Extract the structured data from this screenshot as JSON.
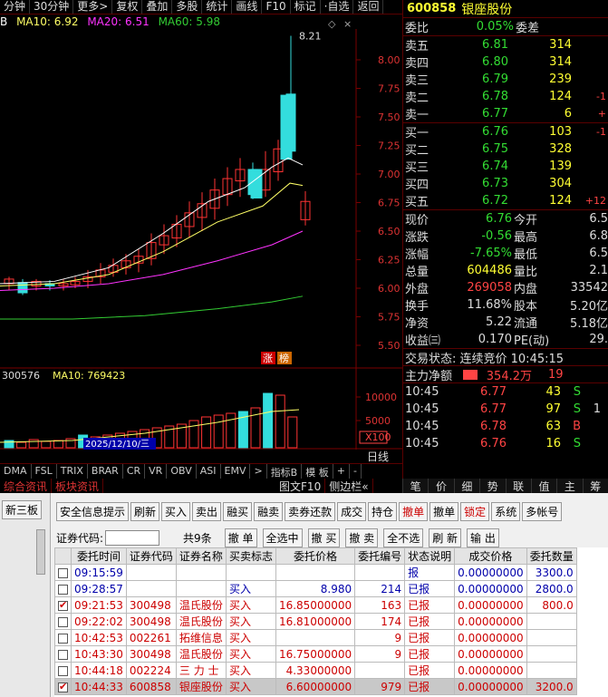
{
  "toolbar": [
    "分钟",
    "30分钟",
    "更多>",
    "复权",
    "叠加",
    "多股",
    "统计",
    "画线",
    "F10",
    "标记",
    "·自选",
    "返回"
  ],
  "ma_legend": {
    "ma5": "B",
    "ma10": "MA10: 6.92",
    "ma20": "MA20: 6.51",
    "ma60": "MA60: 5.98"
  },
  "chart": {
    "price_axis": [
      "8.00",
      "7.75",
      "7.50",
      "7.25",
      "7.00",
      "6.75",
      "6.50",
      "6.25",
      "6.00",
      "5.75",
      "5.50"
    ],
    "high_label": "8.21",
    "badges": [
      "涨",
      "榜"
    ],
    "vol_legend": "300576",
    "vol_ma": "MA10: 769423",
    "vol_axis": [
      "10000",
      "5000",
      "X100"
    ],
    "date_label": "2025/12/10/三",
    "period": "日线",
    "colors": {
      "up": "#ff3333",
      "down": "#33dddd",
      "ma5": "#ffffff",
      "ma10": "#ffff66",
      "ma20": "#ff33ff",
      "ma60": "#33cc33"
    }
  },
  "indicator_tabs": [
    "DMA",
    "FSL",
    "TRIX",
    "BRAR",
    "CR",
    "VR",
    "OBV",
    "ASI",
    "EMV",
    ">",
    "指标B",
    "模 板",
    "+",
    "-"
  ],
  "bottom_tabs": [
    "综合资讯",
    "板块资讯",
    "图文F10",
    "侧边栏«"
  ],
  "bottom_right_tabs": [
    "笔",
    "价",
    "细",
    "势",
    "联",
    "值",
    "主",
    "筹"
  ],
  "quote": {
    "code": "600858",
    "name": "银座股份",
    "weibi_label": "委比",
    "weibi_value": "0.05%",
    "weicha_label": "委差",
    "asks": [
      {
        "label": "卖五",
        "price": "6.81",
        "vol": "314",
        "chg": ""
      },
      {
        "label": "卖四",
        "price": "6.80",
        "vol": "314",
        "chg": ""
      },
      {
        "label": "卖三",
        "price": "6.79",
        "vol": "239",
        "chg": ""
      },
      {
        "label": "卖二",
        "price": "6.78",
        "vol": "124",
        "chg": "-1"
      },
      {
        "label": "卖一",
        "price": "6.77",
        "vol": "6",
        "chg": "+"
      }
    ],
    "bids": [
      {
        "label": "买一",
        "price": "6.76",
        "vol": "103",
        "chg": "-1"
      },
      {
        "label": "买二",
        "price": "6.75",
        "vol": "328",
        "chg": ""
      },
      {
        "label": "买三",
        "price": "6.74",
        "vol": "139",
        "chg": ""
      },
      {
        "label": "买四",
        "price": "6.73",
        "vol": "304",
        "chg": ""
      },
      {
        "label": "买五",
        "price": "6.72",
        "vol": "124",
        "chg": "+12"
      }
    ],
    "stats": [
      {
        "l1": "现价",
        "v1": "6.76",
        "l2": "今开",
        "v2": "6.5"
      },
      {
        "l1": "涨跌",
        "v1": "-0.56",
        "l2": "最高",
        "v2": "6.8"
      },
      {
        "l1": "涨幅",
        "v1": "-7.65%",
        "l2": "最低",
        "v2": "6.5"
      },
      {
        "l1": "总量",
        "v1": "604486",
        "l2": "量比",
        "v2": "2.1"
      },
      {
        "l1": "外盘",
        "v1": "269058",
        "l2": "内盘",
        "v2": "33542"
      },
      {
        "l1": "换手",
        "v1": "11.68%",
        "l2": "股本",
        "v2": "5.20亿"
      },
      {
        "l1": "净资",
        "v1": "5.22",
        "l2": "流通",
        "v2": "5.18亿"
      },
      {
        "l1": "收益㈢",
        "v1": "0.170",
        "l2": "PE(动)",
        "v2": "29."
      }
    ],
    "trade_status": "交易状态: 连续竞价 10:45:15",
    "main_flow_label": "主力净额",
    "main_flow_value": "354.2万",
    "main_flow_extra": "19",
    "ticks": [
      {
        "time": "10:45",
        "price": "6.77",
        "vol": "43",
        "side": "S",
        "extra": ""
      },
      {
        "time": "10:45",
        "price": "6.77",
        "vol": "97",
        "side": "S",
        "extra": "1"
      },
      {
        "time": "10:45",
        "price": "6.78",
        "vol": "63",
        "side": "B",
        "extra": ""
      },
      {
        "time": "10:45",
        "price": "6.76",
        "vol": "16",
        "side": "S",
        "extra": ""
      }
    ]
  },
  "trade": {
    "side_tab": "新三板",
    "buttons": [
      "安全信息提示",
      "刷新",
      "买入",
      "卖出",
      "融买",
      "融卖",
      "卖券还款",
      "成交",
      "持仓",
      "撤单",
      "撤单",
      "锁定",
      "系统",
      "多帐号"
    ],
    "code_label": "证券代码:",
    "count_label": "共9条",
    "actions": [
      "撤 单",
      "全选中",
      "撤 买",
      "撤 卖",
      "全不选",
      "刷 新",
      "输 出"
    ],
    "columns": [
      "委托时间",
      "证券代码",
      "证券名称",
      "买卖标志",
      "委托价格",
      "委托编号",
      "状态说明",
      "成交价格",
      "委托数量"
    ],
    "rows": [
      {
        "checked": false,
        "time": "09:15:59",
        "code": "",
        "name": "",
        "side": "",
        "price": "",
        "id": "",
        "status": "报",
        "deal": "0.00000000",
        "qty": "3300.0"
      },
      {
        "checked": false,
        "time": "09:28:57",
        "code": "",
        "name": "",
        "side": "买入",
        "price": "8.980",
        "id": "214",
        "status": "已报",
        "deal": "0.00000000",
        "qty": "2800.0"
      },
      {
        "checked": true,
        "time": "09:21:53",
        "code": "300498",
        "name": "温氏股份",
        "side": "买入",
        "price": "16.85000000",
        "id": "163",
        "status": "已报",
        "deal": "0.00000000",
        "qty": "800.0"
      },
      {
        "checked": false,
        "time": "09:22:02",
        "code": "300498",
        "name": "温氏股份",
        "side": "买入",
        "price": "16.81000000",
        "id": "174",
        "status": "已报",
        "deal": "0.00000000",
        "qty": ""
      },
      {
        "checked": false,
        "time": "10:42:53",
        "code": "002261",
        "name": "拓维信息",
        "side": "买入",
        "price": "",
        "id": "9",
        "status": "已报",
        "deal": "0.00000000",
        "qty": ""
      },
      {
        "checked": false,
        "time": "10:43:30",
        "code": "300498",
        "name": "温氏股份",
        "side": "买入",
        "price": "16.75000000",
        "id": "9",
        "status": "已报",
        "deal": "0.00000000",
        "qty": ""
      },
      {
        "checked": false,
        "time": "10:44:18",
        "code": "002224",
        "name": "三 力 士",
        "side": "买入",
        "price": "4.33000000",
        "id": "",
        "status": "已报",
        "deal": "0.00000000",
        "qty": ""
      },
      {
        "checked": true,
        "time": "10:44:33",
        "code": "600858",
        "name": "银座股份",
        "side": "买入",
        "price": "6.60000000",
        "id": "979",
        "status": "已报",
        "deal": "0.00000000",
        "qty": "3200.0"
      }
    ]
  }
}
